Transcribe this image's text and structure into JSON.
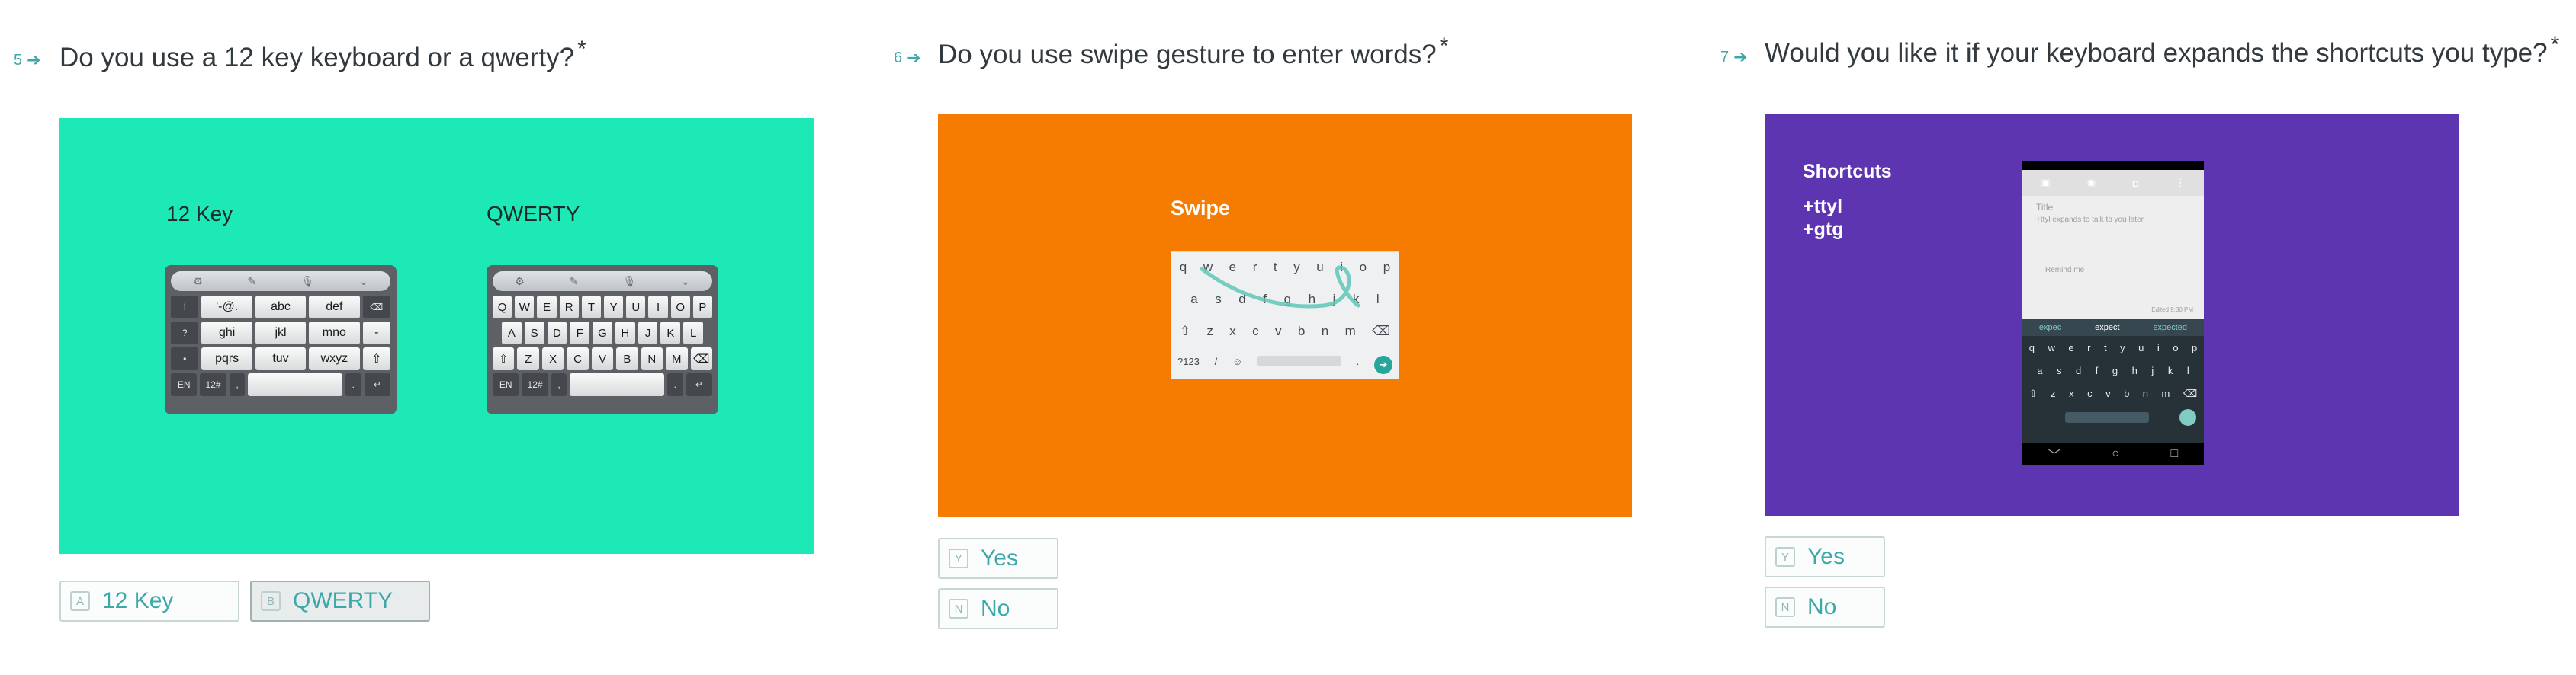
{
  "questions": [
    {
      "number": "5",
      "title": "Do you use a 12 key keyboard or a qwerty?",
      "required_mark": "*",
      "panel_color": "#1de9b6",
      "labels": {
        "left": "12 Key",
        "right": "QWERTY"
      },
      "choices": [
        {
          "key": "A",
          "label": "12 Key",
          "selected": false
        },
        {
          "key": "B",
          "label": "QWERTY",
          "selected": true
        }
      ],
      "twelve_key": {
        "rows": [
          [
            "!",
            "'-@.",
            "abc",
            "def",
            "⌫"
          ],
          [
            "?",
            "ghi",
            "jkl",
            "mno",
            "-"
          ],
          [
            "•",
            "pqrs",
            "tuv",
            "wxyz",
            "⇧"
          ],
          [
            "EN",
            "12#",
            ",",
            "",
            ".",
            "↵"
          ]
        ]
      },
      "qwerty_key": {
        "rows": [
          [
            "Q",
            "W",
            "E",
            "R",
            "T",
            "Y",
            "U",
            "I",
            "O",
            "P"
          ],
          [
            "A",
            "S",
            "D",
            "F",
            "G",
            "H",
            "J",
            "K",
            "L"
          ],
          [
            "⇧",
            "Z",
            "X",
            "C",
            "V",
            "B",
            "N",
            "M",
            "⌫"
          ],
          [
            "EN",
            "12#",
            ",",
            "",
            ".",
            "↵"
          ]
        ]
      }
    },
    {
      "number": "6",
      "title": "Do you use swipe gesture to enter words?",
      "required_mark": "*",
      "panel_color": "#f57c00",
      "panel_label": "Swipe",
      "choices": [
        {
          "key": "Y",
          "label": "Yes",
          "selected": false
        },
        {
          "key": "N",
          "label": "No",
          "selected": false
        }
      ],
      "swipe_keyboard": {
        "rows": [
          [
            "q",
            "w",
            "e",
            "r",
            "t",
            "y",
            "u",
            "i",
            "o",
            "p"
          ],
          [
            "a",
            "s",
            "d",
            "f",
            "g",
            "h",
            "j",
            "k",
            "l"
          ],
          [
            "⇧",
            "z",
            "x",
            "c",
            "v",
            "b",
            "n",
            "m",
            "⌫"
          ],
          [
            "?123",
            "/",
            "☺",
            "",
            "."
          ]
        ]
      }
    },
    {
      "number": "7",
      "title": "Would you like it if your keyboard expands the shortcuts you type?",
      "required_mark": "*",
      "panel_color": "#5e35b1",
      "panel_heading": "Shortcuts",
      "panel_lines": [
        "+ttyl",
        "+gtg"
      ],
      "choices": [
        {
          "key": "Y",
          "label": "Yes",
          "selected": false
        },
        {
          "key": "N",
          "label": "No",
          "selected": false
        }
      ],
      "phone": {
        "note_title": "Title",
        "note_body": "+ttyl expands to talk to you later",
        "remind": "Remind me",
        "edited": "Edited 9:30 PM",
        "suggestions": [
          "expec",
          "expect",
          "expected"
        ],
        "rows": [
          [
            "q",
            "w",
            "e",
            "r",
            "t",
            "y",
            "u",
            "i",
            "o",
            "p"
          ],
          [
            "a",
            "s",
            "d",
            "f",
            "g",
            "h",
            "j",
            "k",
            "l"
          ],
          [
            "⇧",
            "z",
            "x",
            "c",
            "v",
            "b",
            "n",
            "m",
            "⌫"
          ]
        ]
      }
    }
  ]
}
